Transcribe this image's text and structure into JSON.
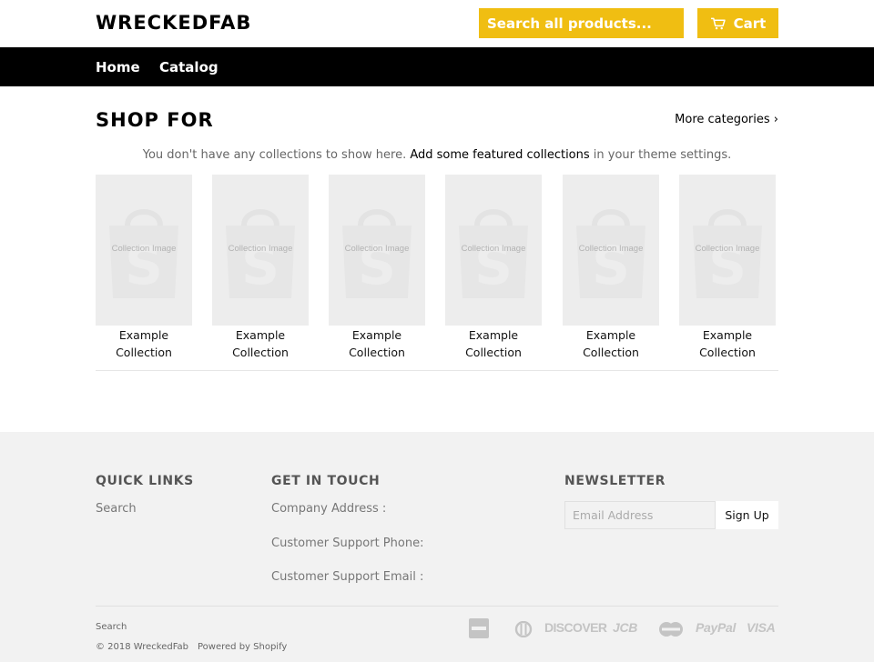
{
  "header": {
    "logo": "WRECKEDFAB",
    "search_placeholder": "Search all products...",
    "cart_label": "Cart",
    "accent_color": "#f0be12"
  },
  "nav": {
    "items": [
      {
        "label": "Home"
      },
      {
        "label": "Catalog"
      }
    ]
  },
  "main": {
    "section_title": "SHOP FOR",
    "more_categories": "More categories ›",
    "notice_before": "You don't have any collections to show here. ",
    "notice_link": "Add some featured collections",
    "notice_after": " in your theme settings.",
    "collections": [
      {
        "placeholder": "Collection Image",
        "name_line1": "Example",
        "name_line2": "Collection"
      },
      {
        "placeholder": "Collection Image",
        "name_line1": "Example",
        "name_line2": "Collection"
      },
      {
        "placeholder": "Collection Image",
        "name_line1": "Example",
        "name_line2": "Collection"
      },
      {
        "placeholder": "Collection Image",
        "name_line1": "Example",
        "name_line2": "Collection"
      },
      {
        "placeholder": "Collection Image",
        "name_line1": "Example",
        "name_line2": "Collection"
      },
      {
        "placeholder": "Collection Image",
        "name_line1": "Example",
        "name_line2": "Collection"
      }
    ]
  },
  "footer": {
    "quick_links_title": "QUICK LINKS",
    "quick_links": [
      "Search"
    ],
    "contact_title": "GET IN TOUCH",
    "contact_lines": [
      "Company Address :",
      "Customer Support Phone:",
      "Customer Support Email :"
    ],
    "newsletter_title": "NEWSLETTER",
    "email_placeholder": "Email Address",
    "signup_label": "Sign Up",
    "bottom_link": "Search",
    "copyright": "© 2018 WreckedFab",
    "powered_by": "Powered by Shopify",
    "payment_icons": [
      "american-express-icon",
      "diners-club-icon",
      "discover-icon",
      "jcb-icon",
      "master-icon",
      "paypal-icon",
      "visa-icon"
    ],
    "payment_labels": {
      "discover": "DISCOVER",
      "jcb": "JCB",
      "paypal": "PayPal",
      "visa": "VISA"
    }
  }
}
